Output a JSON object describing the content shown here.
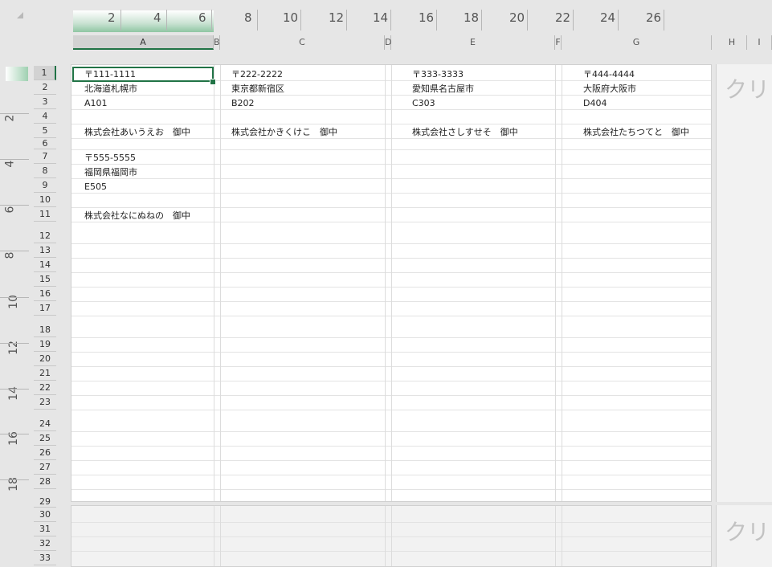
{
  "ruler": {
    "horizontal_labels": [
      "2",
      "4",
      "6",
      "8",
      "10",
      "12",
      "14",
      "16",
      "18",
      "20",
      "22",
      "24",
      "26"
    ],
    "vertical_labels": [
      "2",
      "4",
      "6",
      "8",
      "10",
      "12",
      "14",
      "16",
      "18"
    ]
  },
  "columns": [
    "A",
    "B",
    "C",
    "D",
    "E",
    "F",
    "G",
    "H",
    "I"
  ],
  "rows": [
    "1",
    "2",
    "3",
    "4",
    "5",
    "6",
    "7",
    "8",
    "9",
    "10",
    "11",
    "12",
    "13",
    "14",
    "15",
    "16",
    "17",
    "18",
    "19",
    "20",
    "21",
    "22",
    "23",
    "24",
    "25",
    "26",
    "27",
    "28",
    "29",
    "30",
    "31",
    "32",
    "33"
  ],
  "cells": {
    "A1": "〒111-1111",
    "A2": "北海道札幌市",
    "A3": "A101",
    "A5": "株式会社あいうえお　御中",
    "A7": "〒555-5555",
    "A8": "福岡県福岡市",
    "A9": "E505",
    "A11": "株式会社なにぬねの　御中",
    "C1": "〒222-2222",
    "C2": "東京都新宿区",
    "C3": "B202",
    "C5": "株式会社かきくけこ　御中",
    "E1": "〒333-3333",
    "E2": "愛知県名古屋市",
    "E3": "C303",
    "E5": "株式会社さしすせそ　御中",
    "G1": "〒444-4444",
    "G2": "大阪府大阪市",
    "G3": "D404",
    "G5": "株式会社たちつてと　御中"
  },
  "selected_cell": "A1",
  "page_overlay_text": "クリッ",
  "colors": {
    "accent": "#217346",
    "background": "#e6e6e6",
    "page": "#ffffff"
  }
}
